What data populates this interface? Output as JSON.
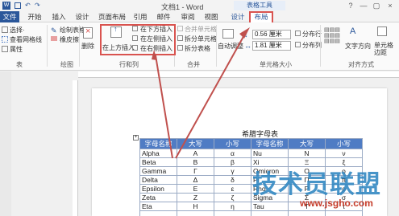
{
  "titlebar": {
    "doc_title": "文档1 - Word",
    "tools_label": "表格工具",
    "help": "?",
    "minimize": "—",
    "restore": "▢",
    "close": "×"
  },
  "tabs": [
    "文件",
    "开始",
    "插入",
    "设计",
    "页面布局",
    "引用",
    "邮件",
    "审阅",
    "视图",
    "设计",
    "布局"
  ],
  "ribbon": {
    "select": "选择·",
    "gridlines": "查看网格线",
    "properties": "属性",
    "group_table": "表",
    "draw_table": "绘制表格",
    "eraser": "橡皮擦",
    "group_draw": "绘图",
    "delete": "删除",
    "insert_above": "在上方插入",
    "insert_below": "在下方插入",
    "insert_left": "在左侧插入",
    "insert_right": "在右侧插入",
    "group_rows_cols": "行和列",
    "merge_cells": "合并单元格",
    "split_cells": "拆分单元格",
    "split_table": "拆分表格",
    "group_merge": "合并",
    "autofit": "自动调整",
    "row_height": "0.56 厘米",
    "col_width": "1.81 厘米",
    "distribute_rows": "分布行",
    "distribute_cols": "分布列",
    "group_cell_size": "单元格大小",
    "text_direction": "文字方向",
    "cell_margins": "单元格边距",
    "group_align": "对齐方式"
  },
  "table": {
    "title": "希腊字母表",
    "headers": [
      "字母名称",
      "大写",
      "小写",
      "字母名称",
      "大写",
      "小写"
    ],
    "rows": [
      [
        "Alpha",
        "A",
        "α",
        "Nu",
        "N",
        "ν"
      ],
      [
        "Beta",
        "B",
        "β",
        "Xi",
        "Ξ",
        "ξ"
      ],
      [
        "Gamma",
        "Γ",
        "γ",
        "Omicron",
        "O",
        "ο"
      ],
      [
        "Delta",
        "Δ",
        "δ",
        "Pi",
        "Π",
        "π"
      ],
      [
        "Epsilon",
        "E",
        "ε",
        "Rho",
        "P",
        "ρ"
      ],
      [
        "Zeta",
        "Z",
        "ζ",
        "Sigma",
        "Σ",
        "σ"
      ],
      [
        "Eta",
        "H",
        "η",
        "Tau",
        "T",
        "τ"
      ],
      [
        "",
        "",
        "",
        "",
        "",
        ""
      ]
    ]
  },
  "watermark": {
    "text": "技术员联盟",
    "url": "www.jsgho.com"
  },
  "colors": {
    "accent": "#2b579a",
    "highlight": "#d9534f",
    "header_fill": "#4f7cc4"
  }
}
